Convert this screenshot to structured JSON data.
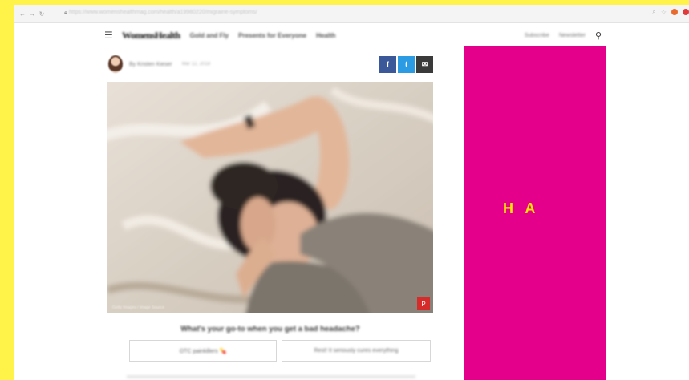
{
  "browser": {
    "url": "https://www.womenshealthmag.com/health/a19980220/migraine-symptoms/",
    "back_icon": "back-arrow-icon",
    "forward_icon": "forward-arrow-icon",
    "reload_icon": "reload-icon",
    "lock_icon": "lock-icon"
  },
  "site": {
    "logo": "WomensHealth",
    "nav": [
      "Gold and Fly",
      "Presents for Everyone",
      "Health"
    ],
    "subscribe": "Subscribe",
    "newsletter": "Newsletter",
    "menu_icon": "hamburger-menu-icon",
    "search_icon": "search-icon"
  },
  "byline": {
    "author": "By Kristen Kieser",
    "date": "Mar 12, 2018"
  },
  "share": {
    "facebook": "f",
    "twitter": "t",
    "email": "✉"
  },
  "hero": {
    "credit": "Getty Images / Image Source",
    "pin": "P"
  },
  "poll": {
    "question": "What's your go-to when you get a bad headache?",
    "options": [
      "OTC painkillers 💊",
      "Rest! It seriously cures everything"
    ]
  },
  "ad": {
    "text": "H A",
    "background": "#e5008c",
    "text_color": "#ffe600"
  },
  "colors": {
    "frame": "#fff34a"
  }
}
